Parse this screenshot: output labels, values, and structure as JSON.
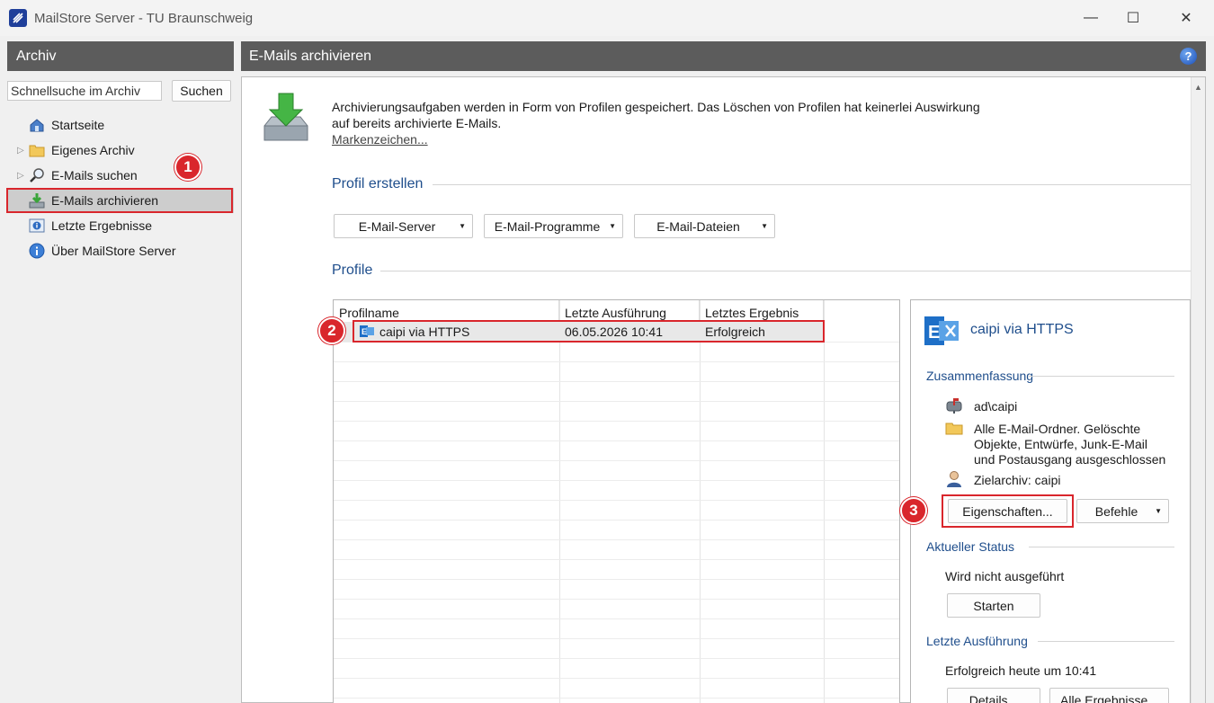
{
  "window": {
    "title": "MailStore Server - TU Braunschweig",
    "minimize_glyph": "—",
    "maximize_glyph": "☐",
    "close_glyph": "✕"
  },
  "sidebar": {
    "header": "Archiv",
    "search_placeholder": "Schnellsuche im Archiv",
    "search_button": "Suchen",
    "items": [
      {
        "label": "Startseite",
        "icon": "home-icon"
      },
      {
        "label": "Eigenes Archiv",
        "icon": "folder-icon"
      },
      {
        "label": "E-Mails suchen",
        "icon": "magnifier-icon"
      },
      {
        "label": "E-Mails archivieren",
        "icon": "archive-download-icon",
        "selected": true
      },
      {
        "label": "Letzte Ergebnisse",
        "icon": "info-list-icon"
      },
      {
        "label": "Über MailStore Server",
        "icon": "info-icon"
      }
    ],
    "step_badge": "1"
  },
  "main": {
    "header": "E-Mails archivieren",
    "intro": "Archivierungsaufgaben werden in Form von Profilen gespeichert. Das Löschen von Profilen hat keinerlei Auswirkung auf bereits archivierte E-Mails.",
    "link": "Markenzeichen...",
    "section_create": "Profil erstellen",
    "create_buttons": [
      "E-Mail-Server",
      "E-Mail-Programme",
      "E-Mail-Dateien"
    ],
    "section_profiles": "Profile",
    "table": {
      "columns": [
        "Profilname",
        "Letzte Ausführung",
        "Letztes Ergebnis"
      ],
      "rows": [
        {
          "name": "caipi via HTTPS",
          "last_run": "06.05.2026 10:41",
          "result": "Erfolgreich"
        }
      ]
    },
    "step_badge": "2"
  },
  "details": {
    "title": "caipi via HTTPS",
    "summary_title": "Zusammenfassung",
    "user": "ad\\caipi",
    "folders": "Alle E-Mail-Ordner. Gelöschte Objekte, Entwürfe, Junk-E-Mail und Postausgang ausgeschlossen",
    "target": "Zielarchiv: caipi",
    "properties_button": "Eigenschaften...",
    "commands_button": "Befehle",
    "status_title": "Aktueller Status",
    "status_text": "Wird nicht ausgeführt",
    "start_button": "Starten",
    "last_run_title": "Letzte Ausführung",
    "last_run_text": "Erfolgreich heute um 10:41",
    "details_button": "Details...",
    "all_results_button": "Alle Ergebnisse...",
    "step_badge": "3"
  },
  "colors": {
    "header_bg": "#5c5c5c",
    "accent_text": "#1f4e8c",
    "highlight_red": "#d9262c"
  }
}
